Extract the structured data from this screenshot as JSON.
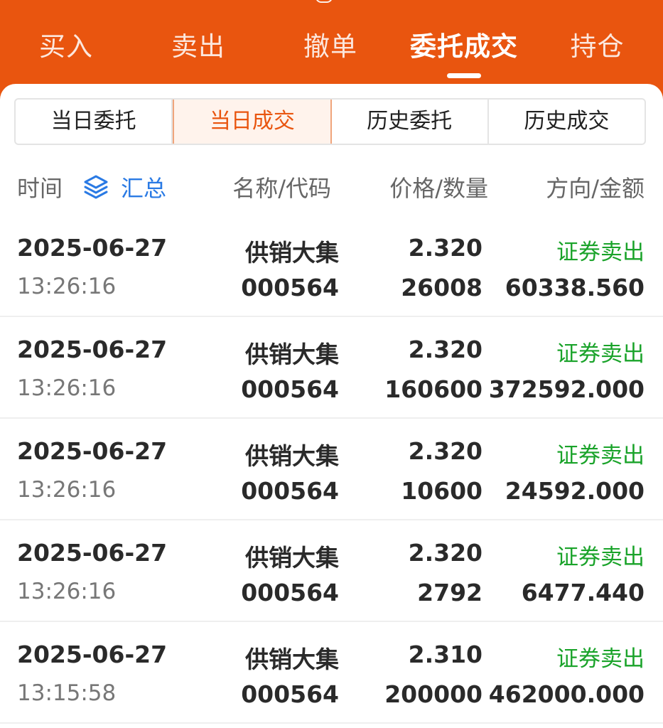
{
  "tabs": [
    "买入",
    "卖出",
    "撤单",
    "委托成交",
    "持仓"
  ],
  "active_tab": "委托成交",
  "segments": [
    "当日委托",
    "当日成交",
    "历史委托",
    "历史成交"
  ],
  "active_segment": "当日成交",
  "header": {
    "time": "时间",
    "summary": "汇总",
    "name_code": "名称/代码",
    "price_qty": "价格/数量",
    "dir_amount": "方向/金额"
  },
  "colors": {
    "brand": "#e9550f",
    "sell": "#1aa32a",
    "link": "#2a7ae4"
  },
  "icons": {
    "summary": "layers-icon"
  },
  "trades": [
    {
      "date": "2025-06-27",
      "time": "13:26:16",
      "name": "供销大集",
      "code": "000564",
      "price": "2.320",
      "quantity": "26008",
      "direction": "证券卖出",
      "amount": "60338.560"
    },
    {
      "date": "2025-06-27",
      "time": "13:26:16",
      "name": "供销大集",
      "code": "000564",
      "price": "2.320",
      "quantity": "160600",
      "direction": "证券卖出",
      "amount": "372592.000"
    },
    {
      "date": "2025-06-27",
      "time": "13:26:16",
      "name": "供销大集",
      "code": "000564",
      "price": "2.320",
      "quantity": "10600",
      "direction": "证券卖出",
      "amount": "24592.000"
    },
    {
      "date": "2025-06-27",
      "time": "13:26:16",
      "name": "供销大集",
      "code": "000564",
      "price": "2.320",
      "quantity": "2792",
      "direction": "证券卖出",
      "amount": "6477.440"
    },
    {
      "date": "2025-06-27",
      "time": "13:15:58",
      "name": "供销大集",
      "code": "000564",
      "price": "2.310",
      "quantity": "200000",
      "direction": "证券卖出",
      "amount": "462000.000"
    }
  ]
}
